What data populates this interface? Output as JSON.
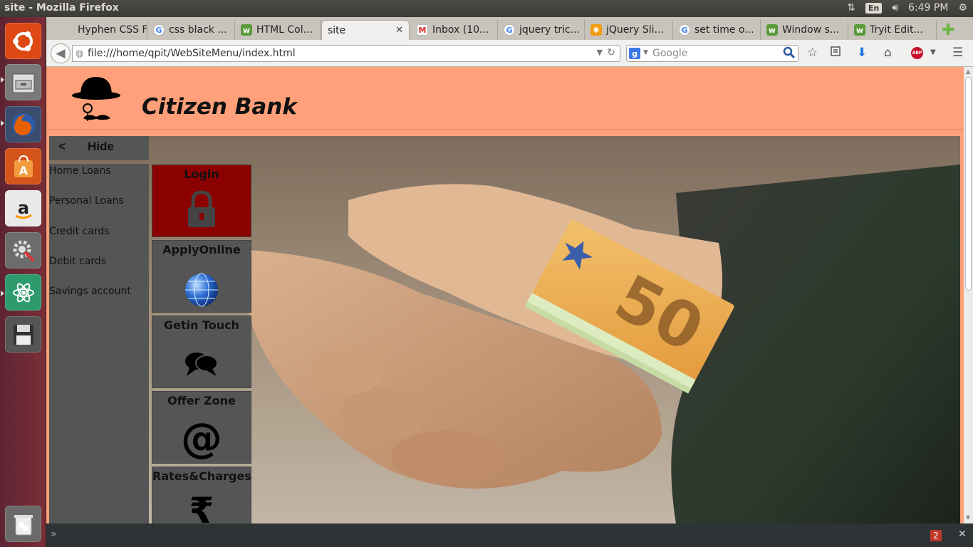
{
  "os": {
    "window_title": "site - Mozilla Firefox",
    "language": "En",
    "clock": "6:49 PM"
  },
  "browser": {
    "tabs": [
      {
        "label": "Hyphen CSS F...",
        "icon": "w3schools-icon"
      },
      {
        "label": "css black ...",
        "icon": "google-icon"
      },
      {
        "label": "HTML Col...",
        "icon": "w3schools-icon"
      },
      {
        "label": "site",
        "icon": "page-icon",
        "active": true
      },
      {
        "label": "Inbox (10...",
        "icon": "gmail-icon"
      },
      {
        "label": "jquery tric...",
        "icon": "google-icon"
      },
      {
        "label": "jQuery Sli...",
        "icon": "asterisk-icon"
      },
      {
        "label": "set time o...",
        "icon": "google-icon"
      },
      {
        "label": "Window s...",
        "icon": "w3schools-icon"
      },
      {
        "label": "Tryit Edit...",
        "icon": "w3schools-icon"
      }
    ],
    "url": "file:///home/qpit/WebSiteMenu/index.html",
    "search_placeholder": "Google",
    "addon_badge": "2"
  },
  "site": {
    "brand": "Citizen Bank",
    "hide_arrow": "<",
    "hide_label": "Hide",
    "menu": [
      "Home Loans",
      "Personal Loans",
      "Credit cards",
      "Debit cards",
      "Savings account"
    ],
    "tiles": [
      {
        "label": "Login",
        "icon": "lock-icon"
      },
      {
        "label": "ApplyOnline",
        "icon": "globe-icon"
      },
      {
        "label": "Getin Touch",
        "icon": "chat-bubbles-icon"
      },
      {
        "label": "Offer Zone",
        "icon": "at-sign-icon"
      },
      {
        "label": "Rates&Charges",
        "icon": "rupee-icon"
      }
    ],
    "tile_icon_glyphs": {
      "at": "@",
      "rupee": "₹"
    },
    "colors": {
      "header": "#ffa07a",
      "menu_bg": "#555555",
      "login_tile": "#8b0000"
    }
  }
}
